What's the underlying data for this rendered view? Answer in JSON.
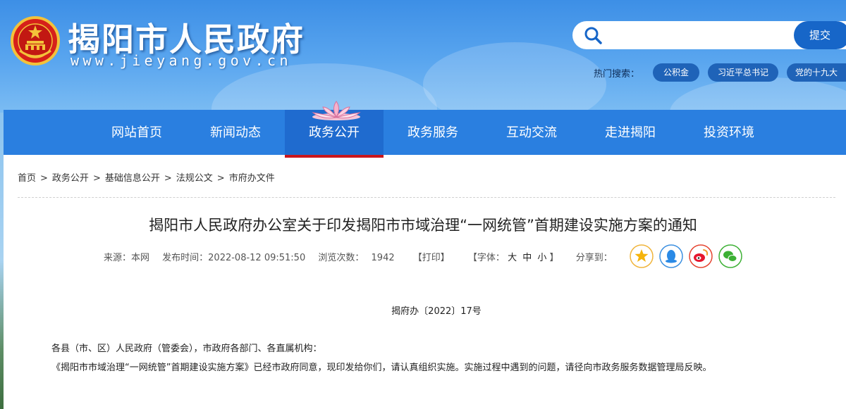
{
  "header": {
    "site_name": "揭阳市人民政府",
    "site_url": "www.jieyang.gov.cn",
    "emblem_icon": "national-emblem-icon"
  },
  "search": {
    "placeholder": "",
    "submit_label": "提交"
  },
  "hot_search": {
    "label": "热门搜索：",
    "tags": [
      "公积金",
      "习近平总书记",
      "党的十九大"
    ]
  },
  "nav": {
    "items": [
      "网站首页",
      "新闻动态",
      "政务公开",
      "政务服务",
      "互动交流",
      "走进揭阳",
      "投资环境"
    ],
    "active": "政务公开",
    "accent": "#c9161d"
  },
  "breadcrumb": [
    "首页",
    "政务公开",
    "基础信息公开",
    "法规公文",
    "市府办文件"
  ],
  "article": {
    "title": "揭阳市人民政府办公室关于印发揭阳市市域治理“一网统管”首期建设实施方案的通知",
    "source": "来源：本网",
    "publish_time": "发布时间：2022-08-12 09:51:50",
    "views_label": "浏览次数：",
    "views": "1942",
    "print_label": "【打印】",
    "font_label": "【字体：",
    "font_sizes": [
      "大",
      "中",
      "小"
    ],
    "font_close": "】",
    "share_label": "分享到：",
    "share_icons": [
      "qzone-star-icon",
      "qq-penguin-icon",
      "weibo-icon",
      "wechat-icon"
    ],
    "doc_number": "揭府办〔2022〕17号",
    "paragraphs": [
      "各县（市、区）人民政府（管委会），市政府各部门、各直属机构：",
      "《揭阳市市域治理“一网统管”首期建设实施方案》已经市政府同意，现印发给你们，请认真组织实施。实施过程中遇到的问题，请径向市政务服务数据管理局反映。"
    ]
  }
}
